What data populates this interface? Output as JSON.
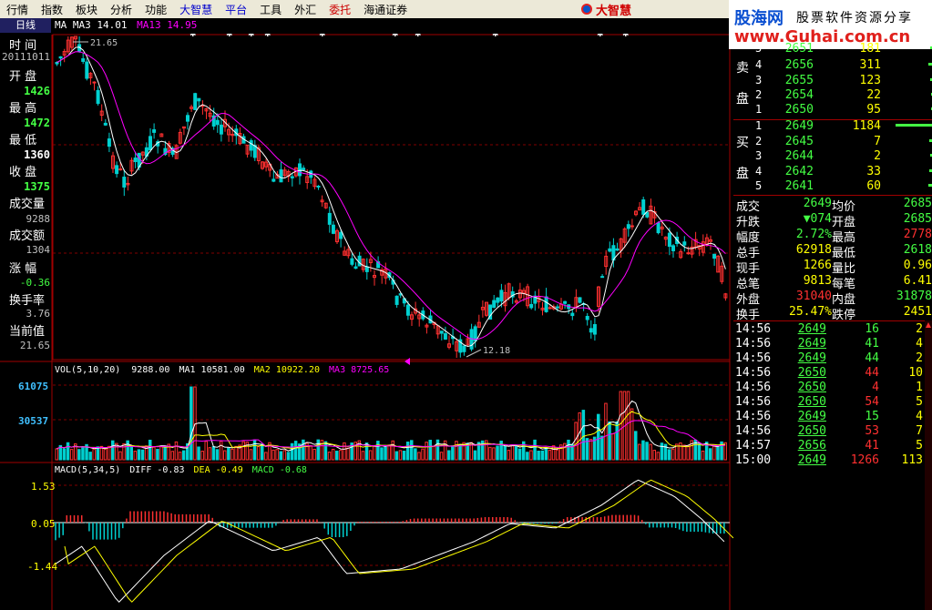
{
  "menu": [
    {
      "label": "行情",
      "color": "#000"
    },
    {
      "label": "指数",
      "color": "#000"
    },
    {
      "label": "板块",
      "color": "#000"
    },
    {
      "label": "分析",
      "color": "#000"
    },
    {
      "label": "功能",
      "color": "#000"
    },
    {
      "label": "大智慧",
      "color": "#0000cc"
    },
    {
      "label": "平台",
      "color": "#0000cc"
    },
    {
      "label": "工具",
      "color": "#000"
    },
    {
      "label": "外汇",
      "color": "#000"
    },
    {
      "label": "委托",
      "color": "#cc0000"
    },
    {
      "label": "海通证券",
      "color": "#000"
    }
  ],
  "logo_text": "大智慧",
  "brand": {
    "line1": "股海网",
    "line1b": "股票软件资源分享",
    "line2": "www.Guhai.com.cn"
  },
  "tab_daily": "日线",
  "ma_legend": {
    "prefix": "MA MA3 14.01",
    "ma13": "MA13 14.95"
  },
  "left": {
    "time_label": "时  间",
    "time_value": "20111011",
    "open_label": "开  盘",
    "open_value": "1426",
    "high_label": "最  高",
    "high_value": "1472",
    "low_label": "最  低",
    "low_value": "1360",
    "close_label": "收  盘",
    "close_value": "1375",
    "volume_label": "成交量",
    "volume_value": "9288",
    "amount_label": "成交额",
    "amount_value": "1304",
    "change_label": "涨  幅",
    "change_value": "-0.36",
    "turnover_label": "换手率",
    "turnover_value": "3.76",
    "current_label": "当前值",
    "current_value": "21.65"
  },
  "price_annotations": {
    "high": "21.65",
    "low": "12.18"
  },
  "vol_legend": {
    "prefix": "VOL(5,10,20)",
    "vol": "9288.00",
    "ma1": "MA1 10581.00",
    "ma2": "MA2 10922.20",
    "ma3": "MA3 8725.65"
  },
  "vol_axis": {
    "top": "61075",
    "mid": "30537"
  },
  "macd_legend": {
    "prefix": "MACD(5,34,5)",
    "diff": "DIFF -0.83",
    "dea": "DEA -0.49",
    "macd": "MACD -0.68"
  },
  "macd_axis": {
    "top": "1.53",
    "mid": "0.05",
    "bot": "-1.44"
  },
  "colors": {
    "up": "#ff3030",
    "down": "#00d0d0",
    "ma": "#ffffff",
    "ma13": "#ff00ff",
    "grid": "#800000",
    "yellow": "#ffff00",
    "green": "#44ff44",
    "cyan": "#40c0ff"
  },
  "orderbook": {
    "sell_label_1": "卖",
    "sell_label_2": "盘",
    "buy_label_1": "买",
    "buy_label_2": "盘",
    "sells": [
      {
        "lv": "5",
        "price": "2651",
        "vol": "181"
      },
      {
        "lv": "4",
        "price": "2656",
        "vol": "311"
      },
      {
        "lv": "3",
        "price": "2655",
        "vol": "123"
      },
      {
        "lv": "2",
        "price": "2654",
        "vol": "22"
      },
      {
        "lv": "1",
        "price": "2650",
        "vol": "95"
      }
    ],
    "buys": [
      {
        "lv": "1",
        "price": "2649",
        "vol": "1184"
      },
      {
        "lv": "2",
        "price": "2645",
        "vol": "7"
      },
      {
        "lv": "3",
        "price": "2644",
        "vol": "2"
      },
      {
        "lv": "4",
        "price": "2642",
        "vol": "33"
      },
      {
        "lv": "5",
        "price": "2641",
        "vol": "60"
      }
    ]
  },
  "stats": [
    {
      "l1": "成交",
      "v1": "2649",
      "c1": "#44ff44",
      "l2": "均价",
      "v2": "2685",
      "c2": "#44ff44"
    },
    {
      "l1": "升跌",
      "v1": "▼074",
      "c1": "#44ff44",
      "l2": "开盘",
      "v2": "2685",
      "c2": "#44ff44"
    },
    {
      "l1": "幅度",
      "v1": "2.72%",
      "c1": "#44ff44",
      "l2": "最高",
      "v2": "2778",
      "c2": "#ff3030"
    },
    {
      "l1": "总手",
      "v1": "62918",
      "c1": "#ffff00",
      "l2": "最低",
      "v2": "2618",
      "c2": "#44ff44"
    },
    {
      "l1": "现手",
      "v1": "1266",
      "c1": "#ffff00",
      "l2": "量比",
      "v2": "0.96",
      "c2": "#ffff00"
    },
    {
      "l1": "总笔",
      "v1": "9813",
      "c1": "#ffff00",
      "l2": "每笔",
      "v2": "6.41",
      "c2": "#ffff00"
    },
    {
      "l1": "外盘",
      "v1": "31040",
      "c1": "#ff3030",
      "l2": "内盘",
      "v2": "31878",
      "c2": "#44ff44"
    },
    {
      "l1": "换手",
      "v1": "25.47%",
      "c1": "#ffff00",
      "l2": "跌停",
      "v2": "2451",
      "c2": "#ffff00"
    }
  ],
  "ticks": [
    {
      "t": "14:56",
      "p": "2649",
      "v": "16",
      "n": "2",
      "vc": "#44ff44"
    },
    {
      "t": "14:56",
      "p": "2649",
      "v": "41",
      "n": "4",
      "vc": "#44ff44"
    },
    {
      "t": "14:56",
      "p": "2649",
      "v": "44",
      "n": "2",
      "vc": "#44ff44"
    },
    {
      "t": "14:56",
      "p": "2650",
      "v": "44",
      "n": "10",
      "vc": "#ff3030"
    },
    {
      "t": "14:56",
      "p": "2650",
      "v": "4",
      "n": "1",
      "vc": "#ff3030"
    },
    {
      "t": "14:56",
      "p": "2650",
      "v": "54",
      "n": "5",
      "vc": "#ff3030"
    },
    {
      "t": "14:56",
      "p": "2649",
      "v": "15",
      "n": "4",
      "vc": "#44ff44"
    },
    {
      "t": "14:56",
      "p": "2650",
      "v": "53",
      "n": "7",
      "vc": "#ff3030"
    },
    {
      "t": "14:57",
      "p": "2656",
      "v": "41",
      "n": "5",
      "vc": "#ff3030"
    },
    {
      "t": "15:00",
      "p": "2649",
      "v": "1266",
      "n": "113",
      "vc": "#ff3030"
    }
  ]
}
